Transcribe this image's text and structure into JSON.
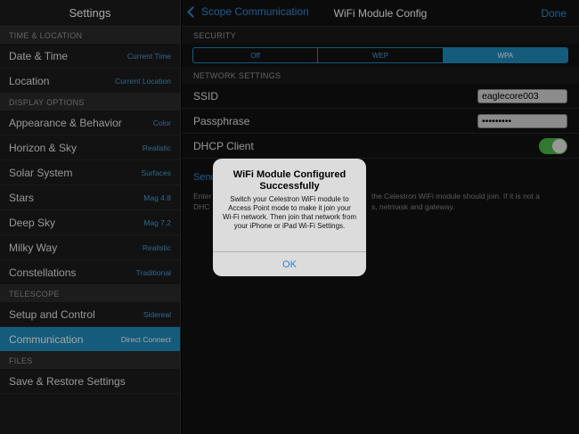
{
  "sidebar": {
    "title": "Settings",
    "sections": {
      "time_location": "TIME & LOCATION",
      "display_options": "DISPLAY OPTIONS",
      "telescope": "TELESCOPE",
      "files": "FILES"
    },
    "items": {
      "date_time": {
        "label": "Date & Time",
        "value": "Current Time"
      },
      "location": {
        "label": "Location",
        "value": "Current Location"
      },
      "appearance": {
        "label": "Appearance & Behavior",
        "value": "Color"
      },
      "horizon": {
        "label": "Horizon & Sky",
        "value": "Realistic"
      },
      "solar": {
        "label": "Solar System",
        "value": "Surfaces"
      },
      "stars": {
        "label": "Stars",
        "value": "Mag 4.8"
      },
      "deep_sky": {
        "label": "Deep Sky",
        "value": "Mag 7.2"
      },
      "milky_way": {
        "label": "Milky Way",
        "value": "Realistic"
      },
      "constellations": {
        "label": "Constellations",
        "value": "Traditional"
      },
      "setup": {
        "label": "Setup and Control",
        "value": "Sidereal"
      },
      "communication": {
        "label": "Communication",
        "value": "Direct Connect"
      },
      "save_restore": {
        "label": "Save & Restore Settings",
        "value": ""
      }
    }
  },
  "nav": {
    "back_label": "Scope Communication",
    "title": "WiFi Module Config",
    "done_label": "Done"
  },
  "main": {
    "security_header": "SECURITY",
    "security_options": [
      "Off",
      "WEP",
      "WPA"
    ],
    "network_header": "NETWORK SETTINGS",
    "ssid_label": "SSID",
    "ssid_value": "eaglecore003",
    "passphrase_label": "Passphrase",
    "passphrase_value": "•••••••••",
    "dhcp_label": "DHCP Client",
    "dhcp_on": true,
    "send_label": "Send",
    "description_left": "Enter\nDHC",
    "description_right": "the Celestron WiFi module should join.  If it is not a\ns, netmask and gateway."
  },
  "alert": {
    "title": "WiFi Module Configured Successfully",
    "message": "Switch your Celestron WiFi module to Access Point mode to make it join your Wi-Fi network.  Then join that network from your iPhone or iPad Wi-Fi Settings.",
    "button": "OK"
  },
  "colors": {
    "accent": "#1f8dbf",
    "link": "#2f8fd8",
    "toggle_on": "#4cb84a"
  }
}
